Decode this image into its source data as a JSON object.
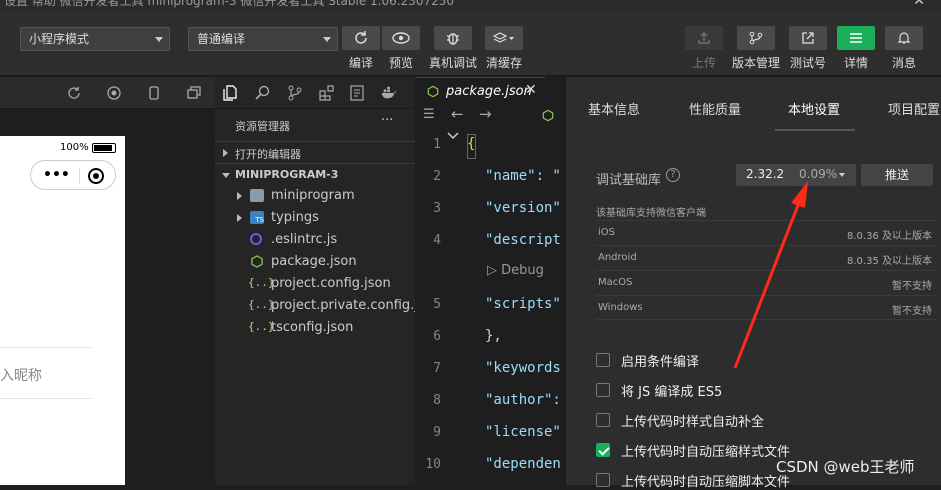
{
  "titlebar": {
    "text": "设置  帮助  微信开发者工具    miniprogram-3    微信开发者工具 Stable 1.06.2307250",
    "close": "✕"
  },
  "toolbar": {
    "mode_select": "小程序模式",
    "compile_select": "普通编译",
    "buttons": {
      "compile": "编译",
      "preview": "预览",
      "real_debug": "真机调试",
      "clear_cache": "清缓存",
      "upload": "上传",
      "version": "版本管理",
      "test_account": "测试号",
      "details": "详情",
      "messages": "消息"
    }
  },
  "simulator": {
    "battery": "100%",
    "nickname_placeholder": "入昵称"
  },
  "explorer": {
    "header": "资源管理器",
    "more": "···",
    "open_editors": "打开的编辑器",
    "project": "MINIPROGRAM-3",
    "files": [
      {
        "name": "miniprogram",
        "type": "folder"
      },
      {
        "name": "typings",
        "type": "ts-folder"
      },
      {
        "name": ".eslintrc.js",
        "type": "eslint"
      },
      {
        "name": "package.json",
        "type": "json-node"
      },
      {
        "name": "project.config.json",
        "type": "json"
      },
      {
        "name": "project.private.config.js...",
        "type": "json"
      },
      {
        "name": "tsconfig.json",
        "type": "json"
      }
    ]
  },
  "editor": {
    "tab": "package.json",
    "codelens": "▷ Debug",
    "lines": [
      {
        "n": "1",
        "t": "{"
      },
      {
        "n": "2",
        "t": "\"name\": \""
      },
      {
        "n": "3",
        "t": "\"version\""
      },
      {
        "n": "4",
        "t": "\"descript"
      },
      {
        "n": "5",
        "t": "\"scripts\""
      },
      {
        "n": "6",
        "t": "},"
      },
      {
        "n": "7",
        "t": "\"keywords"
      },
      {
        "n": "8",
        "t": "\"author\":"
      },
      {
        "n": "9",
        "t": "\"license\""
      },
      {
        "n": "10",
        "t": "\"dependen"
      }
    ]
  },
  "panel": {
    "tabs": [
      "基本信息",
      "性能质量",
      "本地设置",
      "项目配置"
    ],
    "base_lib_label": "调试基础库",
    "base_lib_version": "2.32.2",
    "base_lib_percent": "0.09%",
    "push_button": "推送",
    "support_label": "该基础库支持微信客户端",
    "support_rows": [
      {
        "k": "iOS",
        "v": "8.0.36 及以上版本"
      },
      {
        "k": "Android",
        "v": "8.0.35 及以上版本"
      },
      {
        "k": "MacOS",
        "v": "暂不支持"
      },
      {
        "k": "Windows",
        "v": "暂不支持"
      }
    ],
    "options": [
      {
        "label": "启用条件编译",
        "checked": false
      },
      {
        "label": "将 JS 编译成 ES5",
        "checked": false
      },
      {
        "label": "上传代码时样式自动补全",
        "checked": false
      },
      {
        "label": "上传代码时自动压缩样式文件",
        "checked": true
      },
      {
        "label": "上传代码时自动压缩脚本文件",
        "checked": false
      }
    ]
  },
  "watermark": "CSDN @web王老师",
  "colors": {
    "accent": "#1aad5a",
    "annotation_arrow": "#ff2a1a"
  }
}
